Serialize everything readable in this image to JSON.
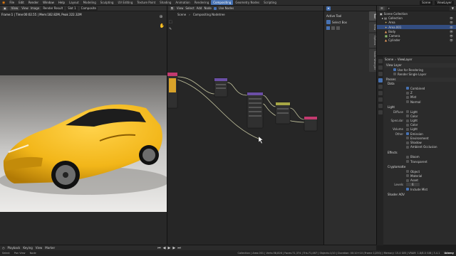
{
  "topbar": {
    "menus": [
      "File",
      "Edit",
      "Render",
      "Window",
      "Help"
    ],
    "workspaces": [
      "Layout",
      "Modeling",
      "Sculpting",
      "UV Editing",
      "Texture Paint",
      "Shading",
      "Animation",
      "Rendering",
      "Compositing",
      "Geometry Nodes",
      "Scripting"
    ],
    "active_workspace": "Compositing",
    "scene": "Scene",
    "view_layer": "ViewLayer"
  },
  "image_editor": {
    "mode": "View",
    "menus": [
      "View",
      "View",
      "Image"
    ],
    "image_name": "Render Result",
    "slot": "Slot 1",
    "layer": "Composite",
    "render_info": "Frame:1 | Time:00:02.55 | Mem:182.82M, Peak 222.32M"
  },
  "node_editor": {
    "menus": [
      "View",
      "Select",
      "Add",
      "Node"
    ],
    "use_nodes_label": "Use Nodes",
    "breadcrumb": [
      "Scene",
      "Compositing Nodetree"
    ],
    "active_tool_title": "Active Tool",
    "active_tool_name": "Select Box"
  },
  "npanel_tabs": [
    "Tool",
    "View",
    "Options",
    "Node Wrangler"
  ],
  "outliner": {
    "title": "Scene Collection",
    "items": [
      {
        "name": "Collection",
        "indent": 1
      },
      {
        "name": "Area",
        "indent": 2
      },
      {
        "name": "Area.001",
        "indent": 2,
        "selected": true
      },
      {
        "name": "Body",
        "indent": 2
      },
      {
        "name": "Camera",
        "indent": 2
      },
      {
        "name": "Cylinder",
        "indent": 2
      }
    ]
  },
  "properties": {
    "scene": "Scene",
    "view_layer": "ViewLayer",
    "view_layer_panel": "View Layer",
    "use_for_rendering": "Use for Rendering",
    "render_single_layer": "Render Single Layer",
    "passes_title": "Passes",
    "data_title": "Data",
    "data_passes": [
      {
        "label": "Combined",
        "on": true
      },
      {
        "label": "Z",
        "on": false
      },
      {
        "label": "Mist",
        "on": false
      },
      {
        "label": "Normal",
        "on": false
      }
    ],
    "light_title": "Light",
    "light_rows": [
      {
        "group": "Diffuse",
        "label": "Light",
        "on": false
      },
      {
        "group": "",
        "label": "Color",
        "on": false
      },
      {
        "group": "Specular",
        "label": "Light",
        "on": false
      },
      {
        "group": "",
        "label": "Color",
        "on": false
      },
      {
        "group": "Volume",
        "label": "Light",
        "on": false
      },
      {
        "group": "Other",
        "label": "Emission",
        "on": true
      },
      {
        "group": "",
        "label": "Environment",
        "on": false
      },
      {
        "group": "",
        "label": "Shadow",
        "on": false
      },
      {
        "group": "",
        "label": "Ambient Occlusion",
        "on": false
      }
    ],
    "effects_title": "Effects",
    "effects_rows": [
      {
        "label": "Bloom",
        "on": false
      },
      {
        "label": "Transparent",
        "on": false
      }
    ],
    "crypto_title": "Cryptomatte",
    "crypto_rows": [
      {
        "label": "Object",
        "on": false
      },
      {
        "label": "Material",
        "on": false
      },
      {
        "label": "Asset",
        "on": false
      }
    ],
    "levels_label": "Levels",
    "levels_value": "6",
    "include_label": "Include Mist",
    "shader_aov": "Shader AOV"
  },
  "timeline": {
    "menus": [
      "Playback",
      "Keying",
      "View",
      "Marker"
    ]
  },
  "statusbar": {
    "left": [
      "Select",
      "Pan View",
      "Node"
    ],
    "stats": "Collection | Area.001 | Verts:58,826 | Faces:71,374 | Tris:71,467 | Objects:1/10 | Duration: 00:10+10 (Frame 1/250) | Memory: 15.4 GiB | VRAM: 1.8/8.0 GiB | 3.4.1",
    "watermark": "Udemy"
  },
  "colors": {
    "accent": "#4772b3",
    "car_yellow": "#f2b619",
    "wire": "#c6c6a0"
  }
}
